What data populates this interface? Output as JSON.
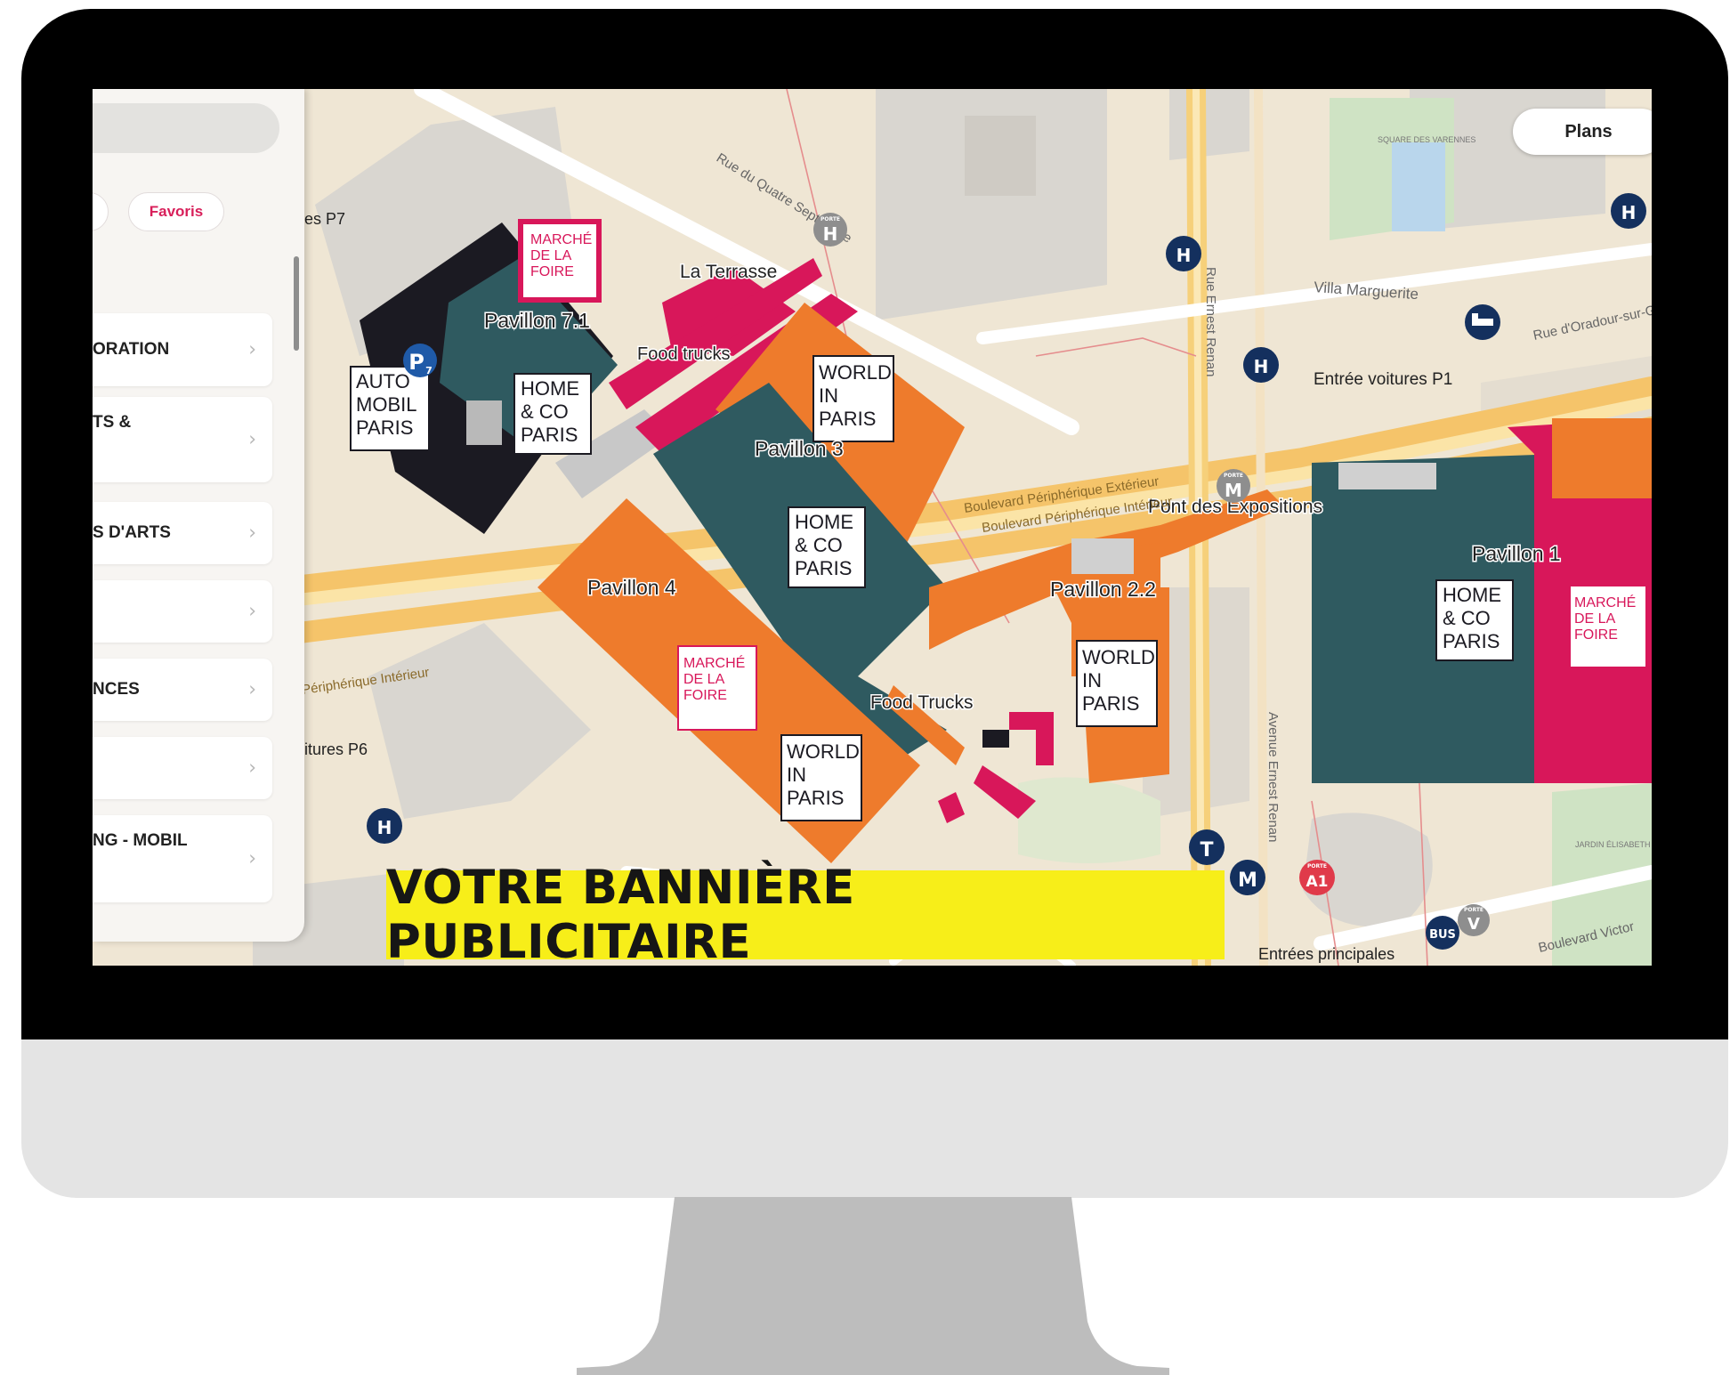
{
  "sidebar": {
    "filters": [
      "",
      "Favoris"
    ],
    "categories": [
      {
        "label": "ORATION"
      },
      {
        "label": "TS &"
      },
      {
        "label": "S D'ARTS"
      },
      {
        "label": ""
      },
      {
        "label": "NCES"
      },
      {
        "label": ""
      },
      {
        "label": "NG - MOBIL"
      }
    ]
  },
  "header": {
    "plans_button": "Plans"
  },
  "map": {
    "pavilions": {
      "p71": "Pavillon 7.1",
      "p3": "Pavillon 3",
      "p4": "Pavillon 4",
      "p22": "Pavillon 2.2",
      "p1": "Pavillon 1"
    },
    "places": {
      "terrasse": "La Terrasse",
      "food_trucks_1": "Food trucks",
      "food_trucks_2": "Food Trucks",
      "pont": "Pont des Expositions",
      "entree_p1": "Entrée voitures P1",
      "voitures_p6": "itures P6",
      "p7_text": "es P7",
      "villa": "Villa Marguerite",
      "square": "SQUARE DES VARENNES",
      "jardin": "JARDIN ÉLISABETH BOSELLI",
      "entrees": "Entrées principales"
    },
    "streets": {
      "quatre": "Rue du Quatre Septembre",
      "renan_rue": "Rue Ernest Renan",
      "renan_av": "Avenue Ernest Renan",
      "oradour": "Rue d'Oradour-sur-Glane",
      "peri_ext": "Boulevard Périphérique Extérieur",
      "peri_int": "Boulevard Périphérique Intérieur",
      "peri_int_left": "Périphérique Intérieur",
      "victor": "Boulevard Victor"
    },
    "logos": {
      "marche": [
        "MARCHÉ",
        "DE LA",
        "FOIRE"
      ],
      "home": [
        "HOME",
        "& CO",
        "PARIS"
      ],
      "world": [
        "WORLD",
        "IN",
        "PARIS"
      ],
      "auto": [
        "AUTO",
        "MOBIL",
        "PARIS"
      ]
    },
    "markers": {
      "parking": "P",
      "parking_num": "7",
      "hotel": "H",
      "tram": "T",
      "metro": "M",
      "bus": "BUS",
      "porte": "PORTE",
      "porte_h": "H",
      "porte_m": "M",
      "porte_a1": "A1",
      "porte_v": "V"
    },
    "colors": {
      "teal": "#2f5a60",
      "orange": "#ee7b2c",
      "pink": "#d8175a",
      "black": "#1b1a22"
    }
  },
  "banner": {
    "text": "VOTRE BANNIÈRE PUBLICITAIRE"
  }
}
